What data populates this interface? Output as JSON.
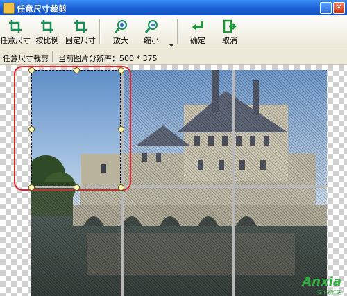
{
  "window": {
    "title": "任意尺寸裁剪"
  },
  "toolbar": {
    "buttons": [
      {
        "id": "free-crop",
        "label": "任意尺寸"
      },
      {
        "id": "ratio-crop",
        "label": "按比例"
      },
      {
        "id": "fixed-crop",
        "label": "固定尺寸"
      },
      {
        "id": "zoom-in",
        "label": "放大"
      },
      {
        "id": "zoom-out",
        "label": "缩小"
      },
      {
        "id": "ok",
        "label": "确定"
      },
      {
        "id": "cancel",
        "label": "取消"
      }
    ]
  },
  "info": {
    "mode": "任意尺寸裁剪",
    "resolution": "当前图片分辨率：500 * 375"
  },
  "watermark": {
    "text": "Anxia",
    "sub": "安下软件站"
  },
  "colors": {
    "accent": "#e0252a",
    "titlebar": "#1a5fd6"
  }
}
